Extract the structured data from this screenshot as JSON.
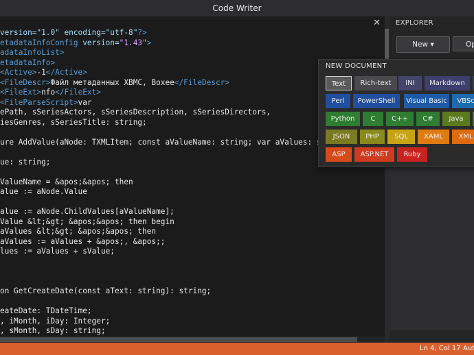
{
  "window": {
    "title": "Code Writer"
  },
  "editor": {
    "close_glyph": "✕",
    "lines": [
      [
        {
          "t": "version=\"1.0\" encoding=\"utf-8\"",
          "c": "attr"
        },
        {
          "t": "?>",
          "c": "tag"
        }
      ],
      [
        {
          "t": "etadataInfoConfig",
          "c": "tag"
        },
        {
          "t": " version=",
          "c": "attr"
        },
        {
          "t": "\"1.43\"",
          "c": "str"
        },
        {
          "t": ">",
          "c": "tag"
        }
      ],
      [
        {
          "t": "adataInfoList>",
          "c": "tag"
        }
      ],
      [
        {
          "t": "etadataInfo>",
          "c": "tag"
        }
      ],
      [
        {
          "t": "<Active>",
          "c": "tag"
        },
        {
          "t": "-1",
          "c": ""
        },
        {
          "t": "</Active>",
          "c": "tag"
        }
      ],
      [
        {
          "t": "<FileDescr>",
          "c": "tag"
        },
        {
          "t": "Файл метаданных XBMC, Boxee",
          "c": ""
        },
        {
          "t": "</FileDescr>",
          "c": "tag"
        }
      ],
      [
        {
          "t": "<FileExt>",
          "c": "tag"
        },
        {
          "t": "nfo",
          "c": ""
        },
        {
          "t": "</FileExt>",
          "c": "tag"
        }
      ],
      [
        {
          "t": "<FileParseScript>",
          "c": "tag"
        },
        {
          "t": "var",
          "c": ""
        }
      ],
      [
        {
          "t": "ePath, sSeriesActors, sSeriesDescription, sSeriesDirectors,",
          "c": ""
        }
      ],
      [
        {
          "t": "iesGenres, sSeriesTitle: string;",
          "c": ""
        }
      ],
      [
        {
          "t": "",
          "c": ""
        }
      ],
      [
        {
          "t": "ure AddValue(aNode: TXMLItem; const aValueName: string; var aValues: stri",
          "c": ""
        }
      ],
      [
        {
          "t": "",
          "c": ""
        }
      ],
      [
        {
          "t": "ue: string;",
          "c": ""
        }
      ],
      [
        {
          "t": "",
          "c": ""
        }
      ],
      [
        {
          "t": "ValueName = &apos;&apos; then",
          "c": ""
        }
      ],
      [
        {
          "t": "alue := aNode.Value",
          "c": ""
        }
      ],
      [
        {
          "t": "",
          "c": ""
        }
      ],
      [
        {
          "t": "alue := aNode.ChildValues[aValueName];",
          "c": ""
        }
      ],
      [
        {
          "t": "Value &lt;&gt; &apos;&apos; then begin",
          "c": ""
        }
      ],
      [
        {
          "t": "aValues &lt;&gt; &apos;&apos; then",
          "c": ""
        }
      ],
      [
        {
          "t": "aValues := aValues + &apos;, &apos;;",
          "c": ""
        }
      ],
      [
        {
          "t": "lues := aValues + sValue;",
          "c": ""
        }
      ],
      [
        {
          "t": "",
          "c": ""
        }
      ],
      [
        {
          "t": "",
          "c": ""
        }
      ],
      [
        {
          "t": "",
          "c": ""
        }
      ],
      [
        {
          "t": "on GetCreateDate(const aText: string): string;",
          "c": ""
        }
      ],
      [
        {
          "t": "",
          "c": ""
        }
      ],
      [
        {
          "t": "eateDate: TDateTime;",
          "c": ""
        }
      ],
      [
        {
          "t": ", iMonth, iDay: Integer;",
          "c": ""
        }
      ],
      [
        {
          "t": ", sMonth, sDay: string;",
          "c": ""
        }
      ]
    ]
  },
  "explorer": {
    "title": "EXPLORER",
    "new_button": "New ▾",
    "open_button": "Op"
  },
  "new_document": {
    "title": "NEW DOCUMENT",
    "types": [
      {
        "label": "Text",
        "bg": "#5a5a5a",
        "border": "#d0d0d0"
      },
      {
        "label": "Rich-text",
        "bg": "#4a4a4e",
        "border": ""
      },
      {
        "label": "INI",
        "bg": "#44456a",
        "border": ""
      },
      {
        "label": "Markdown",
        "bg": "#3d3f6e",
        "border": ""
      },
      {
        "label": "",
        "bg": "#3d3f6e",
        "border": ""
      },
      {
        "label": "Perl",
        "bg": "#1f4f9e",
        "border": ""
      },
      {
        "label": "PowerShell",
        "bg": "#1f4f9e",
        "border": ""
      },
      {
        "label": "Visual Basic",
        "bg": "#1e5aa8",
        "border": ""
      },
      {
        "label": "VBSc",
        "bg": "#1e6ab0",
        "border": ""
      },
      {
        "label": "Python",
        "bg": "#2e7d32",
        "border": ""
      },
      {
        "label": "C",
        "bg": "#2e7d32",
        "border": ""
      },
      {
        "label": "C++",
        "bg": "#2e7d32",
        "border": ""
      },
      {
        "label": "C#",
        "bg": "#2e7d32",
        "border": ""
      },
      {
        "label": "Java",
        "bg": "#5a7a1e",
        "border": ""
      },
      {
        "label": "",
        "bg": "#5a7a1e",
        "border": ""
      },
      {
        "label": "JSON",
        "bg": "#7a7a20",
        "border": ""
      },
      {
        "label": "PHP",
        "bg": "#8a8a1a",
        "border": ""
      },
      {
        "label": "SQL",
        "bg": "#c8a414",
        "border": ""
      },
      {
        "label": "XAML",
        "bg": "#e07b12",
        "border": ""
      },
      {
        "label": "XML",
        "bg": "#e06a10",
        "border": ""
      },
      {
        "label": "ASP",
        "bg": "#d84a1b",
        "border": ""
      },
      {
        "label": "ASP.NET",
        "bg": "#d03a1f",
        "border": ""
      },
      {
        "label": "Ruby",
        "bg": "#c8241f",
        "border": ""
      }
    ]
  },
  "status": {
    "position": "Ln 4, Col 17",
    "encoding": "Aut"
  },
  "colors": {
    "accent": "#d9612d",
    "editor_bg": "#1b1b1b"
  }
}
